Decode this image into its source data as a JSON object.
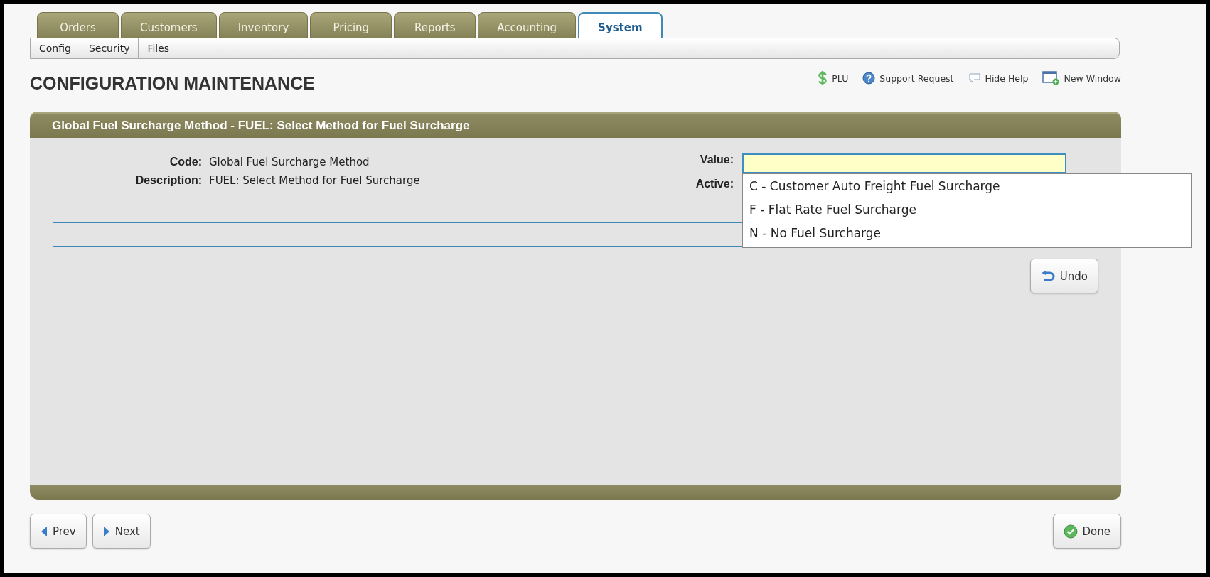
{
  "tabs": [
    {
      "label": "Orders",
      "selected": false
    },
    {
      "label": "Customers",
      "selected": false
    },
    {
      "label": "Inventory",
      "selected": false
    },
    {
      "label": "Pricing",
      "selected": false
    },
    {
      "label": "Reports",
      "selected": false
    },
    {
      "label": "Accounting",
      "selected": false
    },
    {
      "label": "System",
      "selected": true
    }
  ],
  "subtabs": [
    "Config",
    "Security",
    "Files"
  ],
  "page_title": "CONFIGURATION MAINTENANCE",
  "toolbar": [
    {
      "kind": "dollar",
      "label": "PLU"
    },
    {
      "kind": "help",
      "label": "Support Request"
    },
    {
      "kind": "bubble",
      "label": "Hide Help"
    },
    {
      "kind": "window",
      "label": "New Window"
    }
  ],
  "panel": {
    "title": "Global Fuel Surcharge Method - FUEL: Select Method for Fuel Surcharge",
    "fields": [
      {
        "label": "Code:",
        "value": "Global Fuel Surcharge Method"
      },
      {
        "label": "Description:",
        "value": "FUEL: Select Method for Fuel Surcharge"
      }
    ],
    "value_label": "Value:",
    "active_label": "Active:",
    "dropdown": [
      "C - Customer Auto Freight Fuel Surcharge",
      "F - Flat Rate Fuel Surcharge",
      "N - No Fuel Surcharge"
    ],
    "undo": "Undo"
  },
  "footer": {
    "prev": "Prev",
    "next": "Next",
    "done": "Done"
  }
}
